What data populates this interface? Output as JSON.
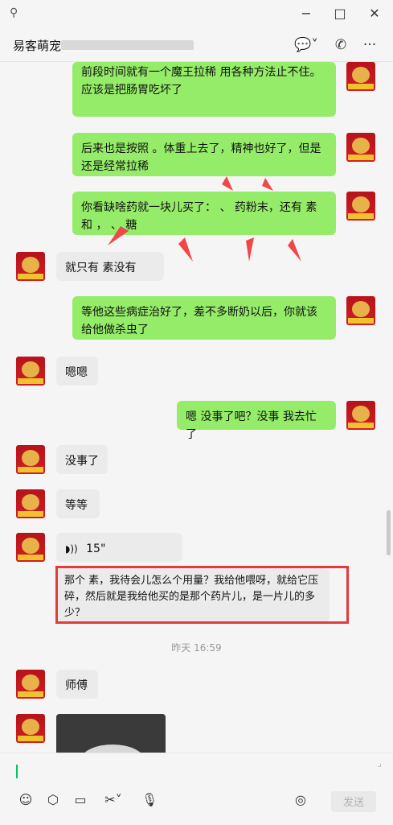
{
  "window": {
    "pin": "⚲",
    "minimize": "−",
    "maximize": "□",
    "close": "✕"
  },
  "header": {
    "title": "易客萌宠",
    "chat_icon": "💬˅",
    "call_icon": "✆",
    "more_icon": "···"
  },
  "messages": [
    {
      "from": "me",
      "text": "前段时间就有一个魔王拉稀 用各种方法止不住。 应该是把肠胃吃坏了"
    },
    {
      "from": "me",
      "text": "后来也是按照 。体重上去了，精神也好了，但是还是经常拉稀"
    },
    {
      "from": "me",
      "text": "你看缺啥药就一块儿买了： 、 药粉末，还有 素和 ， 、 糖"
    },
    {
      "from": "other",
      "text": "就只有 素没有"
    },
    {
      "from": "me",
      "text": "等他这些病症治好了，差不多断奶以后，你就该给他做杀虫了"
    },
    {
      "from": "other",
      "text": "嗯嗯"
    },
    {
      "from": "me",
      "text": "嗯 没事了吧？没事 我去忙了"
    },
    {
      "from": "other",
      "text": "没事了"
    },
    {
      "from": "other",
      "text": "等等"
    },
    {
      "from": "other",
      "voice": "15\""
    },
    {
      "from": "other",
      "text": "那个 素，我待会儿怎么个用量？我给他喂呀，就给它压碎，然后就是我给他买的是那个药片儿，是一片儿的多少？"
    },
    {
      "time": "昨天 16:59"
    },
    {
      "from": "other",
      "text": "师傅"
    }
  ],
  "voice_icon": "◗))",
  "toolbar": {
    "emoji": "☺",
    "box": "⬡",
    "folder": "▭",
    "scissors": "✂˅",
    "mic": "🎙",
    "voice_input": "◎"
  },
  "send_label": "发送"
}
